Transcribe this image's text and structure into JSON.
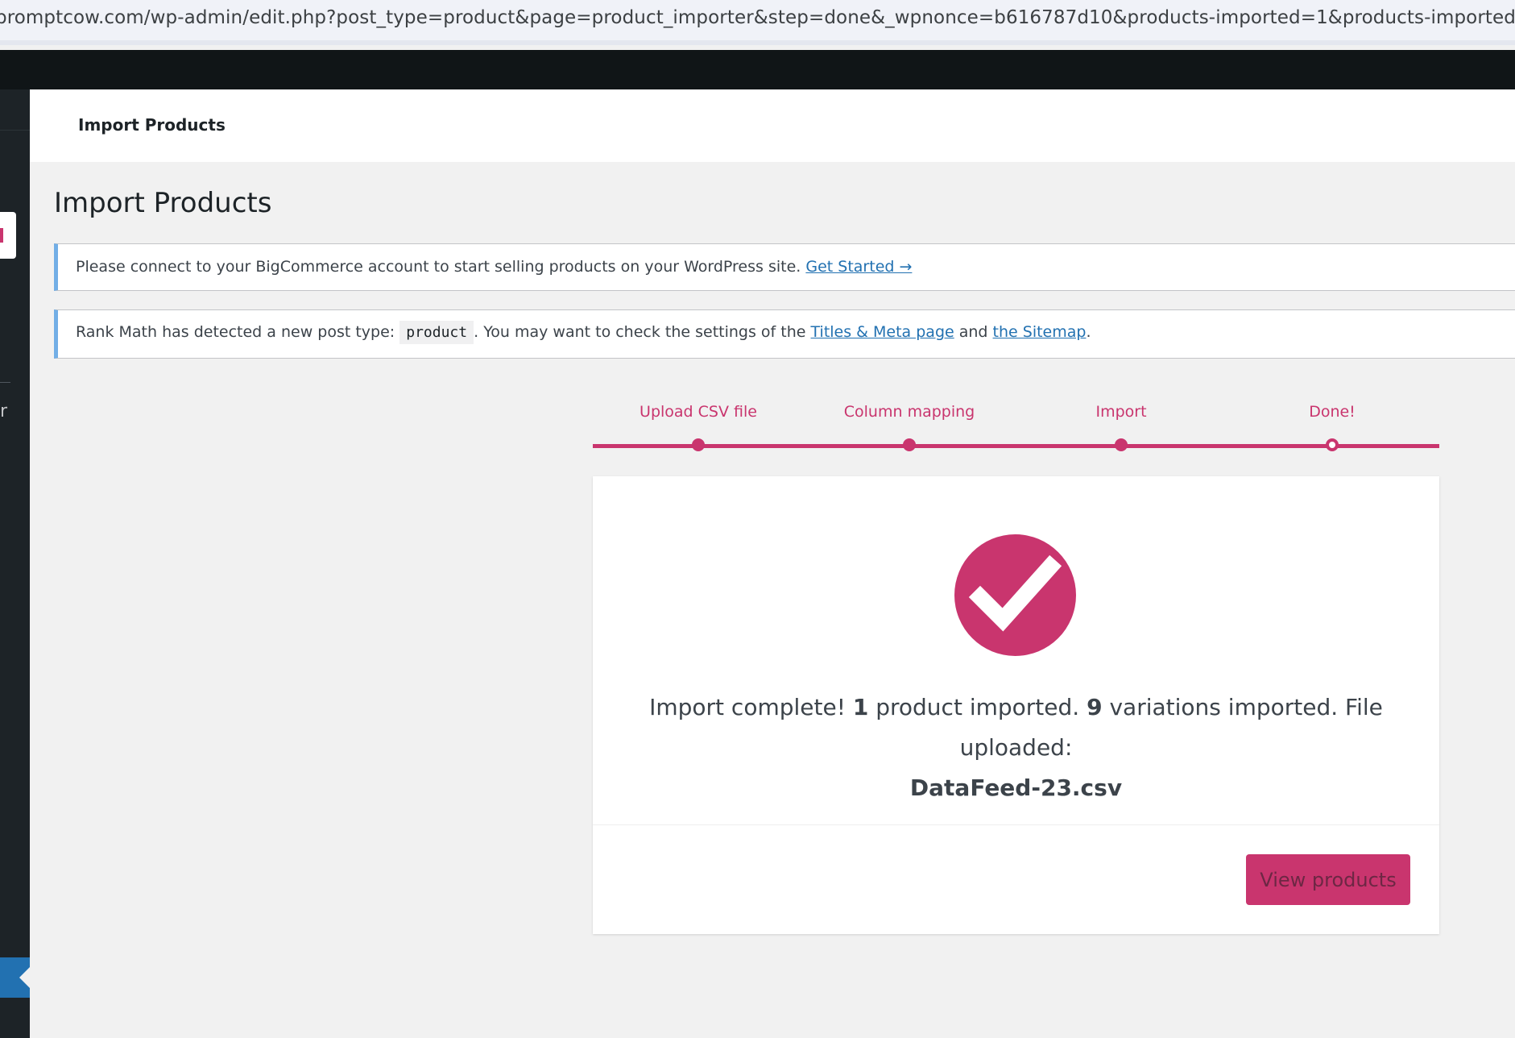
{
  "browser": {
    "url": "promptcow.com/wp-admin/edit.php?post_type=product&page=product_importer&step=done&_wpnonce=b616787d10&products-imported=1&products-imported-variations=9&products"
  },
  "sidebar": {
    "partial_label": "r"
  },
  "header": {
    "title": "Import Products"
  },
  "page": {
    "heading": "Import Products"
  },
  "notices": [
    {
      "text": "Please connect to your BigCommerce account to start selling products on your WordPress site.",
      "link": "Get Started →"
    },
    {
      "text_before": "Rank Math has detected a new post type:",
      "code": "product",
      "text_middle": ". You may want to check the settings of the",
      "link1": "Titles & Meta page",
      "text_and": "and",
      "link2": "the Sitemap",
      "text_end": "."
    }
  ],
  "steps": [
    {
      "label": "Upload CSV file",
      "state": "done"
    },
    {
      "label": "Column mapping",
      "state": "done"
    },
    {
      "label": "Import",
      "state": "done"
    },
    {
      "label": "Done!",
      "state": "current"
    }
  ],
  "result": {
    "part1": "Import complete!",
    "products_count": "1",
    "part2": "product imported.",
    "variations_count": "9",
    "part3": "variations imported. File uploaded:",
    "filename": "DataFeed-23.csv",
    "button_label": "View products"
  },
  "colors": {
    "accent": "#c9356e",
    "notice_border": "#72aee6",
    "admin_bar": "#101517",
    "sidebar": "#1d2327",
    "link": "#2271b1"
  }
}
